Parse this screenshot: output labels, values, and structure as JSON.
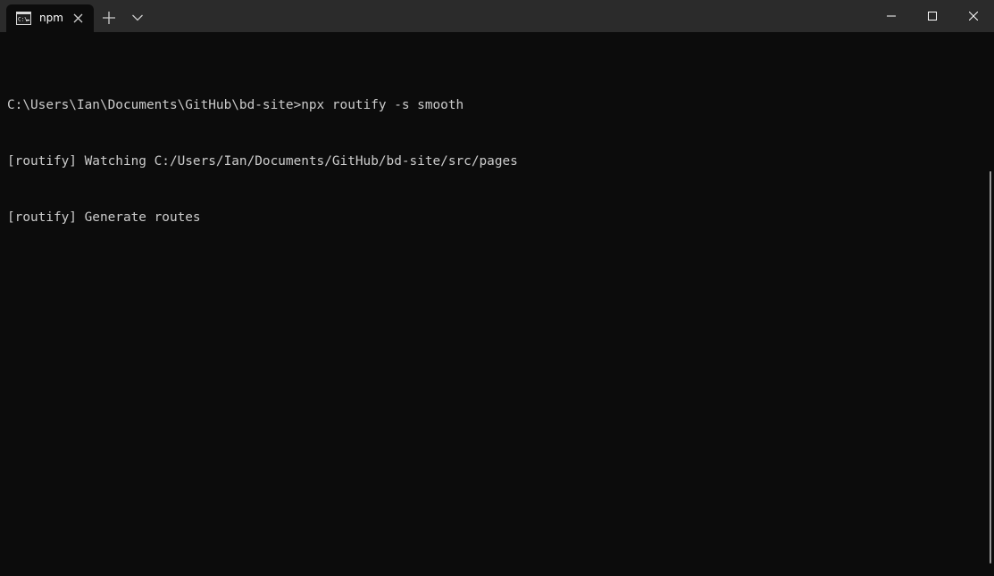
{
  "tab": {
    "title": "npm",
    "icon": "command-prompt-icon"
  },
  "titlebar": {
    "new_tab_icon": "plus-icon",
    "dropdown_icon": "chevron-down-icon",
    "minimize_icon": "minimize-icon",
    "maximize_icon": "maximize-icon",
    "close_icon": "close-icon"
  },
  "terminal": {
    "lines": [
      "C:\\Users\\Ian\\Documents\\GitHub\\bd-site>npx routify -s smooth",
      "[routify] Watching C:/Users/Ian/Documents/GitHub/bd-site/src/pages",
      "[routify] Generate routes"
    ]
  },
  "colors": {
    "background": "#0c0c0c",
    "titlebar": "#2b2b2b",
    "text": "#cccccc"
  }
}
